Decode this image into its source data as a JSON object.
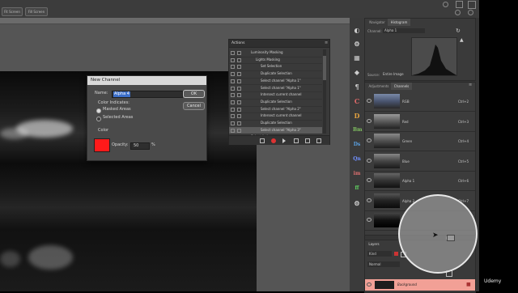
{
  "topbar": {
    "btn1": "Fit Screen",
    "btn2": "Fill Screen"
  },
  "dialog": {
    "title": "New Channel",
    "name_label": "Name:",
    "name_value": "Alpha 4",
    "color_indicates_label": "Color Indicates:",
    "option_masked": "Masked Areas",
    "option_selected": "Selected Areas",
    "color_label": "Color",
    "opacity_label": "Opacity:",
    "opacity_value": "50",
    "percent": "%",
    "ok": "OK",
    "cancel": "Cancel",
    "swatch_color": "#ff1a1a"
  },
  "actions": {
    "title": "Actions",
    "rows": [
      "Luminosity Masking",
      "Lights Masking",
      "Set Selection",
      "Duplicate Selection",
      "Select channel \"Alpha 1\"",
      "Select channel \"Alpha 1\"",
      "Intersect current channel",
      "Duplicate Selection",
      "Select channel \"Alpha 2\"",
      "Intersect current channel",
      "Duplicate Selection",
      "Select channel \"Alpha 3\"",
      "Select Actions"
    ]
  },
  "navigator": {
    "tab1": "Navigator",
    "tab2": "Histogram",
    "channel_label": "Channel:",
    "channel_value": "Alpha 1",
    "source_label": "Source:",
    "source_value": "Entire Image"
  },
  "channels": {
    "tab1": "Adjustments",
    "tab2": "Channels",
    "rows": [
      {
        "name": "RGB",
        "key": "Ctrl+2"
      },
      {
        "name": "Red",
        "key": "Ctrl+3"
      },
      {
        "name": "Green",
        "key": "Ctrl+4"
      },
      {
        "name": "Blue",
        "key": "Ctrl+5"
      },
      {
        "name": "Alpha 1",
        "key": "Ctrl+6"
      },
      {
        "name": "Alpha 2",
        "key": "Ctrl+7"
      },
      {
        "name": "",
        "key": ""
      }
    ]
  },
  "layers": {
    "title": "Layers",
    "kind": "Kind",
    "mode": "Normal",
    "layer_name": "Background"
  },
  "watermark": "Udemy",
  "tool_icons": [
    "C",
    "D",
    "Bm",
    "Ds",
    "Qn",
    "im",
    "ff"
  ]
}
